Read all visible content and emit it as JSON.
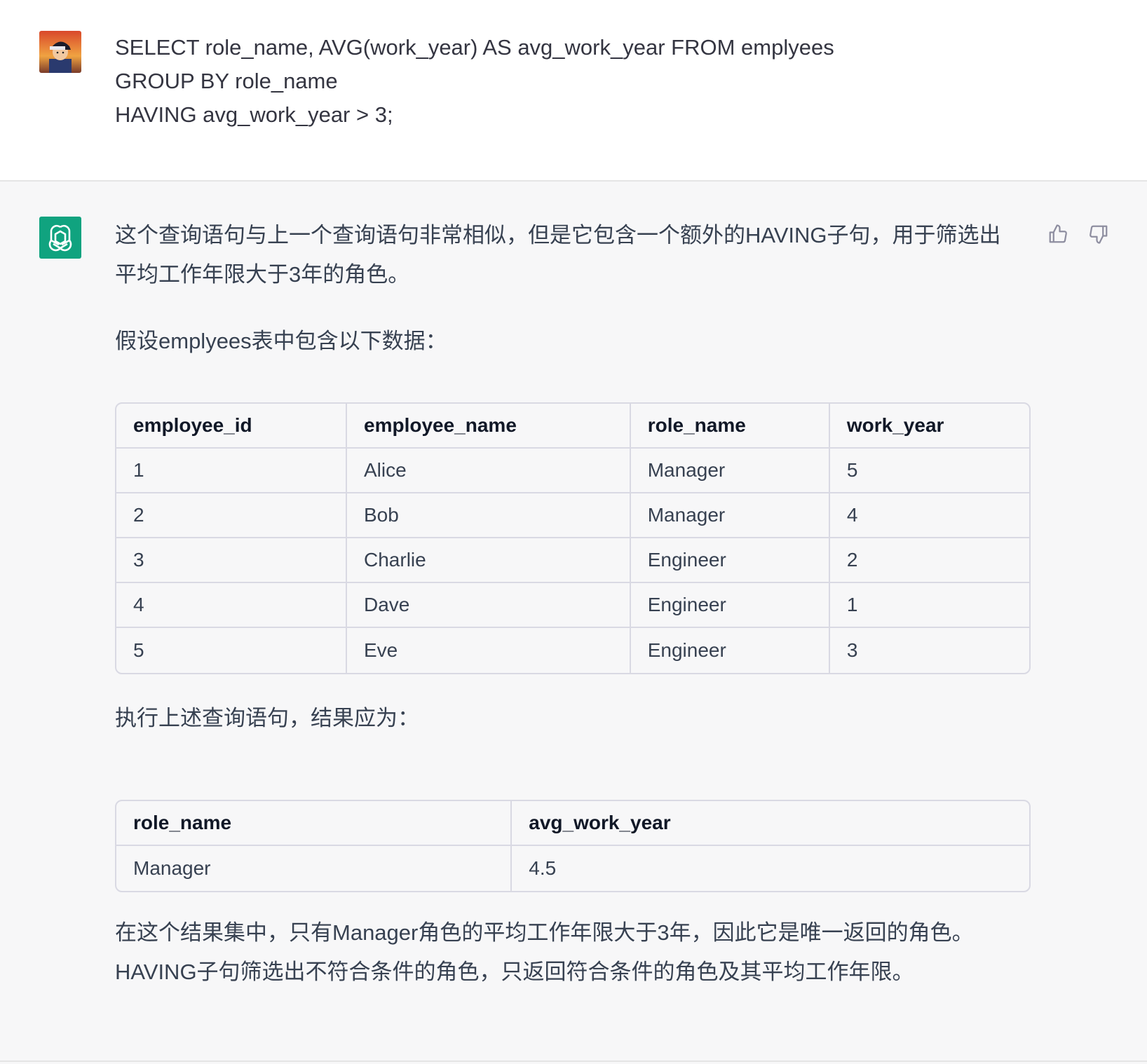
{
  "user_message": {
    "lines": [
      "SELECT role_name, AVG(work_year) AS avg_work_year FROM emplyees",
      "GROUP BY role_name",
      "HAVING avg_work_year > 3;"
    ]
  },
  "assistant_message": {
    "intro_line1": "这个查询语句与上一个查询语句非常相似，但是它包含一个额外的HAVING子句，用于筛选出",
    "intro_line2": "平均工作年限大于3年的角色。",
    "assume_text": "假设emplyees表中包含以下数据：",
    "data_table": {
      "headers": [
        "employee_id",
        "employee_name",
        "role_name",
        "work_year"
      ],
      "rows": [
        [
          "1",
          "Alice",
          "Manager",
          "5"
        ],
        [
          "2",
          "Bob",
          "Manager",
          "4"
        ],
        [
          "3",
          "Charlie",
          "Engineer",
          "2"
        ],
        [
          "4",
          "Dave",
          "Engineer",
          "1"
        ],
        [
          "5",
          "Eve",
          "Engineer",
          "3"
        ]
      ]
    },
    "result_intro": "执行上述查询语句，结果应为：",
    "result_table": {
      "headers": [
        "role_name",
        "avg_work_year"
      ],
      "rows": [
        [
          "Manager",
          "4.5"
        ]
      ]
    },
    "conclusion_line1": "在这个结果集中，只有Manager角色的平均工作年限大于3年，因此它是唯一返回的角色。",
    "conclusion_line2": "HAVING子句筛选出不符合条件的角色，只返回符合条件的角色及其平均工作年限。"
  },
  "icons": {
    "assistant_avatar": "openai-logo-icon",
    "thumbs_up": "thumbs-up-icon",
    "thumbs_down": "thumbs-down-icon"
  },
  "colors": {
    "assistant_avatar_bg": "#10a37f",
    "assistant_bg": "#f7f7f8",
    "user_bg": "#ffffff"
  }
}
